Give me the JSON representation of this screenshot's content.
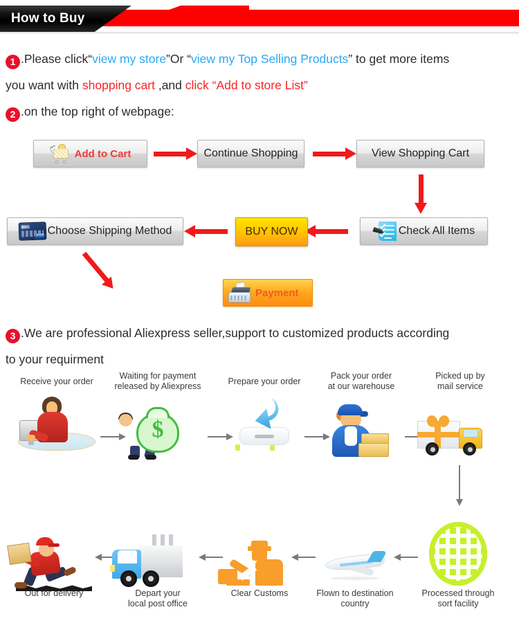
{
  "header": {
    "title": "How to Buy"
  },
  "steps": {
    "one": {
      "number": "1",
      "t1": ".Please click“",
      "link1": "view my store",
      "t2": "”Or “",
      "link2": "view my Top Selling Products",
      "t3": "” to get more items",
      "t4": "you want with ",
      "em1": "shopping cart",
      "t5": " ,and ",
      "em2": "click “Add to store List”"
    },
    "two": {
      "number": "2",
      "text": ".on the top right of webpage:"
    },
    "three": {
      "number": "3",
      "line1": ".We are professional Aliexpress seller,support to customized products according",
      "line2": "to your requirment"
    }
  },
  "flowchart": {
    "buttons": {
      "add_to_cart": "Add to Cart",
      "continue_shopping": "Continue Shopping",
      "view_shopping_cart": "View Shopping Cart",
      "choose_shipping_method": "Choose Shipping Method",
      "buy_now": "BUY NOW",
      "check_all_items": "Check All Items",
      "payment": "Payment"
    },
    "colors": {
      "arrow_red": "#ef1b1b",
      "buy_now_gradient_top": "#ffe400",
      "buy_now_gradient_bottom": "#ff9a14",
      "payment_gradient_top": "#ffd34d",
      "payment_gradient_bottom": "#ff8c10",
      "add_to_cart_text": "#f03a3a"
    }
  },
  "shipping": {
    "row1": [
      {
        "caption": "Receive your order",
        "icon": "person-at-computer-icon"
      },
      {
        "caption": "Waiting for payment\nreleased by Aliexpress",
        "line1": "Waiting for payment",
        "line2": "released by Aliexpress",
        "icon": "money-bag-icon"
      },
      {
        "caption": "Prepare your order",
        "icon": "download-box-icon"
      },
      {
        "caption": "Pack your order\nat our warehouse",
        "line1": "Pack your order",
        "line2": "at our warehouse",
        "icon": "warehouse-worker-icon"
      },
      {
        "caption": "Picked up by\nmail service",
        "line1": "Picked up by",
        "line2": "mail service",
        "icon": "mail-truck-icon"
      }
    ],
    "row2": [
      {
        "caption": "Out for delivery",
        "icon": "delivery-runner-icon"
      },
      {
        "line1": "Depart your",
        "line2": "local post office",
        "icon": "post-truck-icon"
      },
      {
        "caption": "Clear Customs",
        "icon": "customs-officer-icon"
      },
      {
        "line1": "Flown to destination",
        "line2": "country",
        "icon": "airplane-icon"
      },
      {
        "line1": "Processed through",
        "line2": "sort facility",
        "icon": "globe-grid-icon"
      }
    ]
  }
}
